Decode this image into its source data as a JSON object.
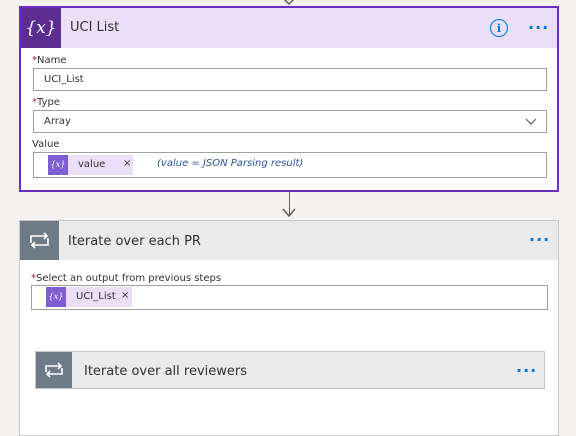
{
  "uci_list": {
    "title": "UCI List",
    "icon": "{x}",
    "name_label": "Name",
    "name_value": "UCI_List",
    "type_label": "Type",
    "type_value": "Array",
    "value_label": "Value",
    "token_icon": "{x}",
    "token_label": "value",
    "token_close": "×",
    "note": "(value = JSON Parsing result)",
    "required_mark": "*",
    "more": "···",
    "info": "i"
  },
  "iterate_pr": {
    "title": "Iterate over each PR",
    "select_label": "Select an output from previous steps",
    "required_mark": "*",
    "token_icon": "{x}",
    "token_label": "UCI_List",
    "token_close": "×",
    "more": "···"
  },
  "iterate_reviewers": {
    "title": "Iterate over all reviewers",
    "more": "···"
  },
  "colors": {
    "accent_purple": "#5c2d91",
    "header_purple": "#ebdff8",
    "link_blue": "#0078d4",
    "loop_gray": "#6d7b88"
  }
}
